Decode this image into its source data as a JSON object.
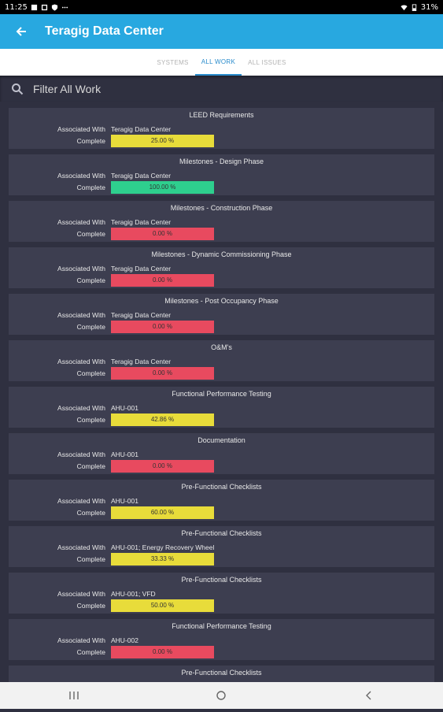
{
  "status": {
    "time": "11:25",
    "battery": "31%",
    "icons": [
      "photo-icon",
      "gallery-icon",
      "shield-icon",
      "more-icon"
    ]
  },
  "header": {
    "title": "Teragig Data Center"
  },
  "tabs": [
    {
      "label": "SYSTEMS",
      "active": false
    },
    {
      "label": "ALL WORK",
      "active": true
    },
    {
      "label": "ALL ISSUES",
      "active": false
    }
  ],
  "filter": {
    "placeholder": "Filter All Work"
  },
  "labels": {
    "associated": "Associated With",
    "complete": "Complete"
  },
  "colors": {
    "yellow": "#e8dc3a",
    "green": "#2ecf8e",
    "red": "#e84a5f",
    "accent": "#28a8e0"
  },
  "cards": [
    {
      "title": "LEED Requirements",
      "associated": "Teragig Data Center",
      "complete": "25.00 %",
      "value": 25.0,
      "color": "yellow"
    },
    {
      "title": "Milestones - Design Phase",
      "associated": "Teragig Data Center",
      "complete": "100.00 %",
      "value": 100.0,
      "color": "green"
    },
    {
      "title": "Milestones - Construction Phase",
      "associated": "Teragig Data Center",
      "complete": "0.00 %",
      "value": 0.0,
      "color": "red"
    },
    {
      "title": "Milestones - Dynamic Commissioning Phase",
      "associated": "Teragig Data Center",
      "complete": "0.00 %",
      "value": 0.0,
      "color": "red"
    },
    {
      "title": "Milestones - Post Occupancy Phase",
      "associated": "Teragig Data Center",
      "complete": "0.00 %",
      "value": 0.0,
      "color": "red"
    },
    {
      "title": "O&M's",
      "associated": "Teragig Data Center",
      "complete": "0.00 %",
      "value": 0.0,
      "color": "red"
    },
    {
      "title": "Functional Performance Testing",
      "associated": "AHU-001",
      "complete": "42.86 %",
      "value": 42.86,
      "color": "yellow"
    },
    {
      "title": "Documentation",
      "associated": "AHU-001",
      "complete": "0.00 %",
      "value": 0.0,
      "color": "red"
    },
    {
      "title": "Pre-Functional Checklists",
      "associated": "AHU-001",
      "complete": "60.00 %",
      "value": 60.0,
      "color": "yellow"
    },
    {
      "title": "Pre-Functional Checklists",
      "associated": "AHU-001; Energy Recovery Wheel",
      "complete": "33.33 %",
      "value": 33.33,
      "color": "yellow"
    },
    {
      "title": "Pre-Functional Checklists",
      "associated": "AHU-001; VFD",
      "complete": "50.00 %",
      "value": 50.0,
      "color": "yellow"
    },
    {
      "title": "Functional Performance Testing",
      "associated": "AHU-002",
      "complete": "0.00 %",
      "value": 0.0,
      "color": "red"
    },
    {
      "title": "Pre-Functional Checklists",
      "associated": "",
      "complete": "",
      "value": null,
      "color": "yellow"
    }
  ]
}
